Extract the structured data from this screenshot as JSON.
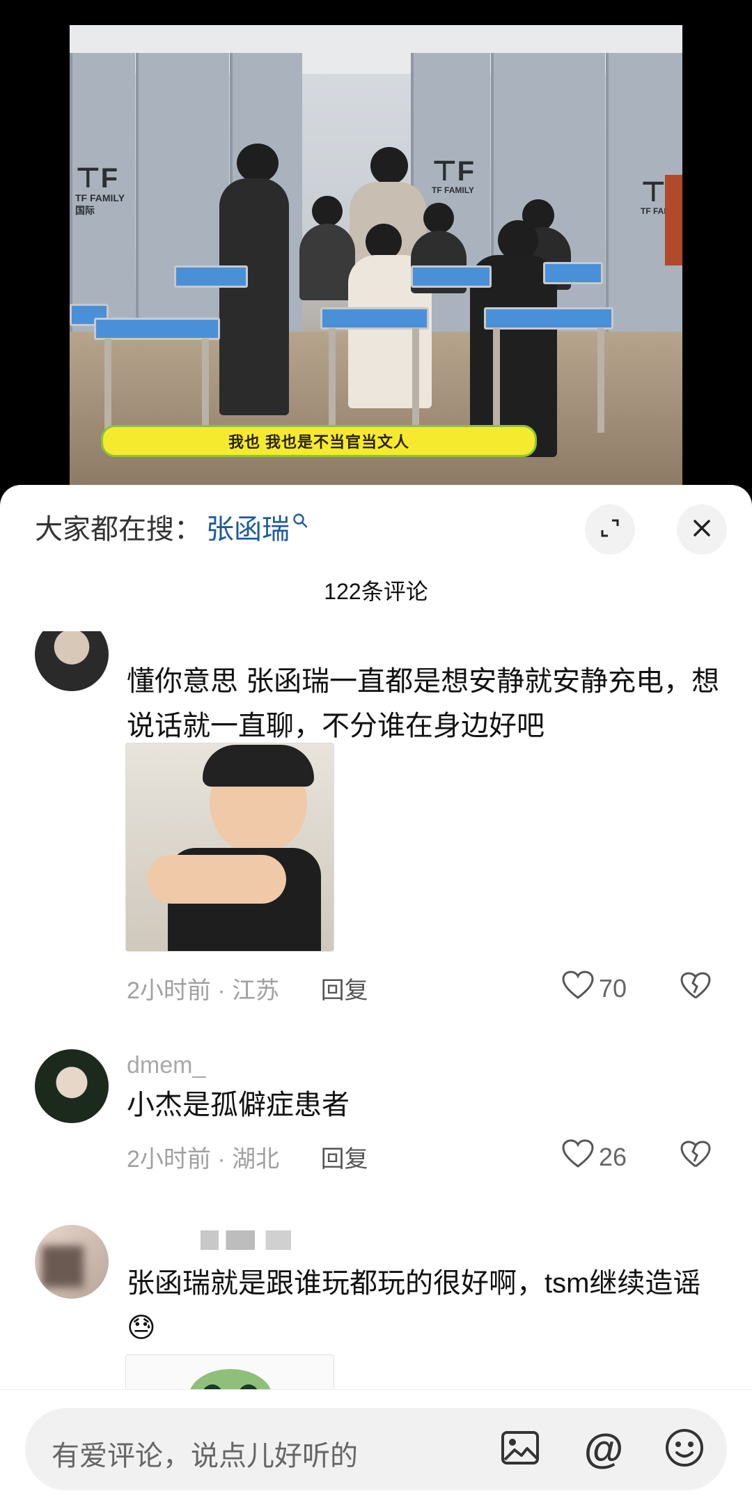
{
  "video": {
    "subtitle": "我也 我也是不当官当文人",
    "logo_left": "TF FAMILY",
    "logo_left_sub": "国际",
    "logo_center": "TF FAMILY",
    "logo_right": "TF FAMILY"
  },
  "search_bar": {
    "prefix": "大家都在搜：",
    "term": "张函瑞"
  },
  "header": {
    "count_title": "122条评论",
    "expand_icon": "expand-icon",
    "close_icon": "close-icon"
  },
  "comments": [
    {
      "username": "",
      "text": "懂你意思 张函瑞一直都是想安静就安静充电，想说话就一直聊，不分谁在身边好吧",
      "time": "2小时前",
      "location": "江苏",
      "reply_label": "回复",
      "likes": "70"
    },
    {
      "username": "dmem_",
      "text": "小杰是孤僻症患者",
      "time": "2小时前",
      "location": "湖北",
      "reply_label": "回复",
      "likes": "26"
    },
    {
      "username": "",
      "text": "张函瑞就是跟谁玩都玩的很好啊，tsm继续造谣😓",
      "time": "",
      "location": "",
      "reply_label": "",
      "likes": ""
    }
  ],
  "meta_separator": " · ",
  "input": {
    "placeholder": "有爱评论，说点儿好听的"
  },
  "colors": {
    "accent_blue": "#1f5b99",
    "subtitle_yellow": "#f5ea2e"
  }
}
